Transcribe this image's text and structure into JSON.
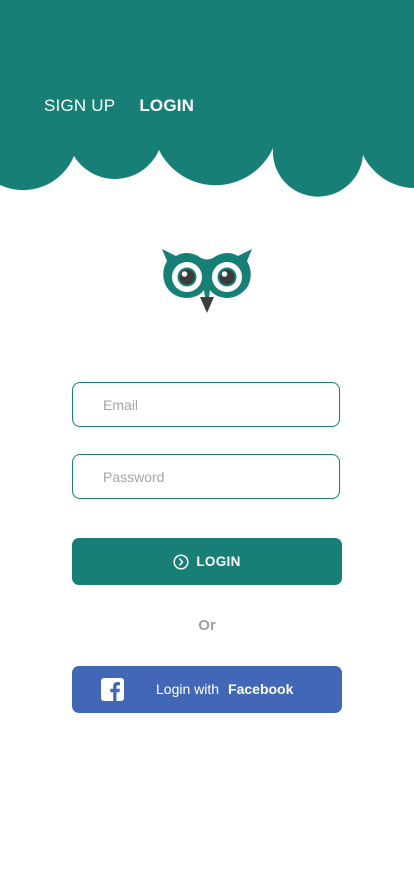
{
  "colors": {
    "brand_teal": "#177f75",
    "facebook_blue": "#4367b7",
    "muted_gray": "#a0a0a0"
  },
  "nav": {
    "tabs": [
      {
        "label": "SIGN UP",
        "active": false
      },
      {
        "label": "LOGIN",
        "active": true
      }
    ]
  },
  "logo": {
    "icon": "owl-logo-icon"
  },
  "form": {
    "email_placeholder": "Email",
    "password_placeholder": "Password",
    "login_label": "LOGIN",
    "login_icon": "chevron-circle-right-icon"
  },
  "divider": {
    "text": "Or"
  },
  "facebook": {
    "prefix": "Login with",
    "brand": "Facebook",
    "icon": "facebook-icon"
  }
}
